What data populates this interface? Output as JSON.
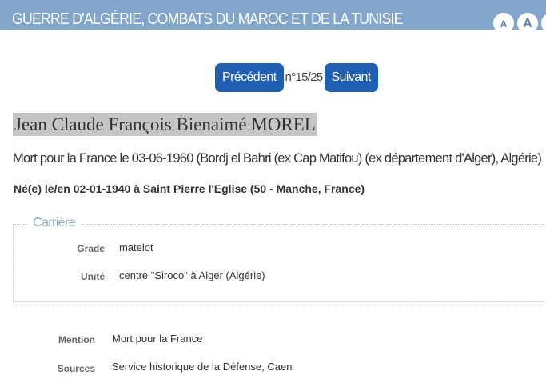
{
  "header": {
    "title": "GUERRE D'ALGÉRIE, COMBATS DU MAROC ET DE LA TUNISIE",
    "font_small": "A",
    "font_big": "A",
    "font_bigger": "A"
  },
  "pager": {
    "previous_label": "Précédent",
    "count": "n°15/25",
    "next_label": "Suivant"
  },
  "person": {
    "name": "Jean Claude François Bienaimé MOREL",
    "death": "Mort pour la France le 03-06-1960 (Bordj el Bahri (ex Cap Matifou) (ex département d'Alger), Algérie)",
    "birth": "Né(e) le/en 02-01-1940 à Saint Pierre l'Eglise (50 - Manche, France)"
  },
  "career": {
    "legend": "Carrière",
    "fields": [
      {
        "label": "Grade",
        "value": "matelot"
      },
      {
        "label": "Unité",
        "value": "centre \"Siroco\" à Alger (Algérie)"
      }
    ]
  },
  "details": [
    {
      "label": "Mention",
      "value": "Mort pour la France"
    },
    {
      "label": "Sources",
      "value": "Service historique de la Défense, Caen"
    }
  ],
  "colors": {
    "header_band": "#82a6cb",
    "button": "#1f5eb0",
    "name_highlight": "#c5c5c5",
    "legend": "#8fa7c0"
  }
}
